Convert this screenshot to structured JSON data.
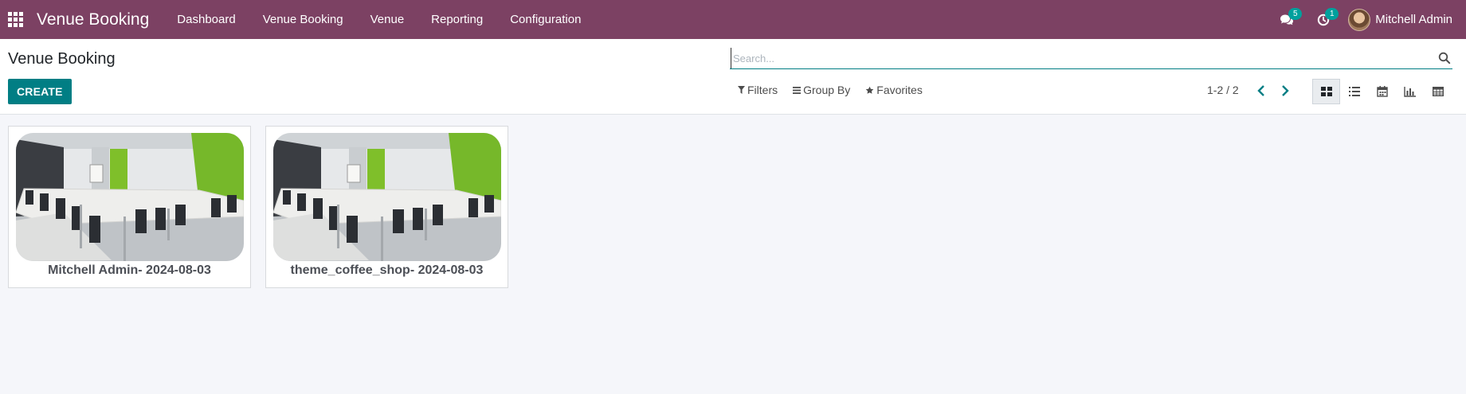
{
  "navbar": {
    "app_title": "Venue Booking",
    "menu": [
      {
        "label": "Dashboard"
      },
      {
        "label": "Venue Booking"
      },
      {
        "label": "Venue"
      },
      {
        "label": "Reporting"
      },
      {
        "label": "Configuration"
      }
    ],
    "messages_count": "5",
    "activities_count": "1",
    "user_name": "Mitchell Admin"
  },
  "control_panel": {
    "title": "Venue Booking",
    "create_label": "CREATE",
    "search_placeholder": "Search...",
    "filters_label": "Filters",
    "group_by_label": "Group By",
    "favorites_label": "Favorites",
    "pager_text": "1-2 / 2",
    "views": [
      "kanban",
      "list",
      "calendar",
      "graph",
      "pivot"
    ],
    "active_view": "kanban"
  },
  "records": [
    {
      "title": "Mitchell Admin- 2024-08-03"
    },
    {
      "title": "theme_coffee_shop- 2024-08-03"
    }
  ],
  "colors": {
    "navbar": "#7c4163",
    "primary": "#017e84",
    "badge": "#00a09d",
    "background": "#f5f6fa"
  }
}
